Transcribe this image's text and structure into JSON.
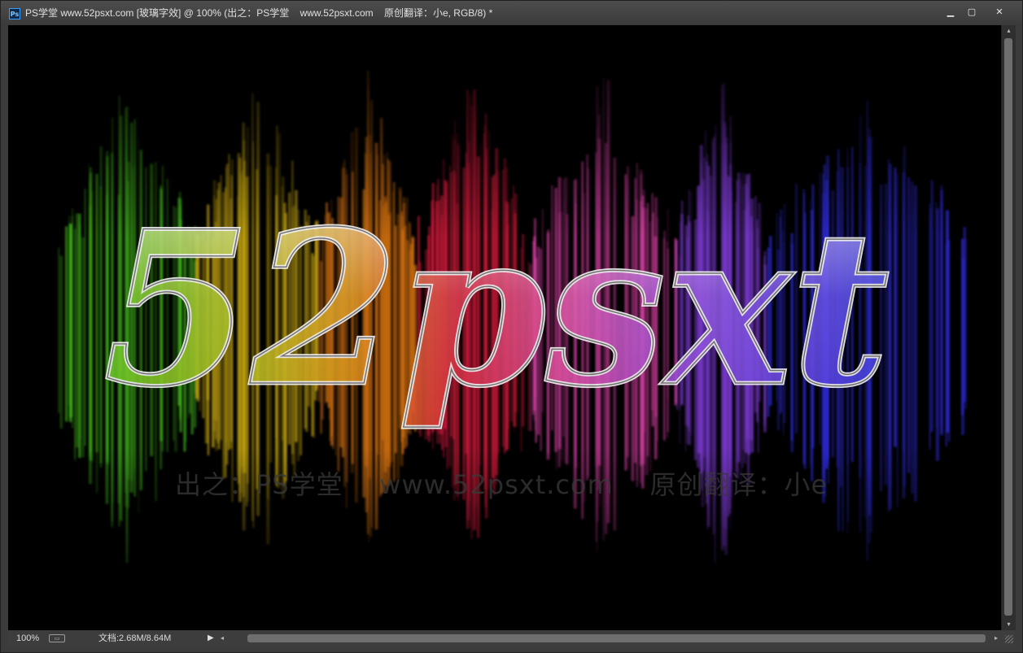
{
  "window": {
    "app_icon": "Ps",
    "title": "PS学堂 www.52psxt.com [玻璃字效] @ 100% (出之：PS学堂    www.52psxt.com    原创翻译：小e, RGB/8) *",
    "buttons": {
      "minimize": "▁",
      "maximize": "▢",
      "close": "✕"
    }
  },
  "canvas": {
    "artwork_text": "52psxt",
    "watermark": "出之：PS学堂    www.52psxt.com    原创翻译：小e",
    "colors": {
      "green": "#3fae1a",
      "yellow": "#c7a70d",
      "orange": "#d27010",
      "red": "#d11a3a",
      "magenta": "#d23fa0",
      "purple": "#7a3ad0",
      "blue": "#2d2bd8"
    }
  },
  "statusbar": {
    "zoom": "100%",
    "doc_info": "文档:2.68M/8.64M",
    "play_icon": "▶",
    "scroll_left_icon": "◂",
    "scroll_right_icon": "▸"
  },
  "scrollbar": {
    "up_icon": "▴",
    "down_icon": "▾"
  }
}
